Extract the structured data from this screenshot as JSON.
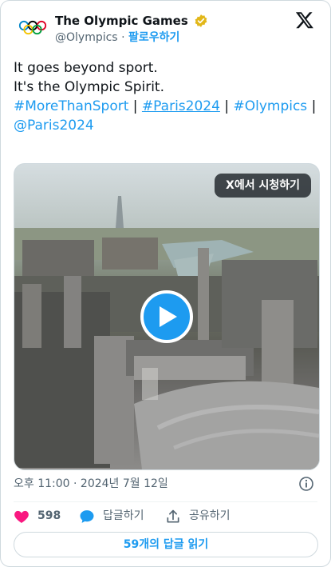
{
  "header": {
    "display_name": "The Olympic Games",
    "handle": "@Olympics",
    "dot": "·",
    "follow_label": "팔로우하기"
  },
  "tweet": {
    "line1": "It goes beyond sport.",
    "line2": "It's the Olympic Spirit.",
    "tags": [
      "#MoreThanSport",
      "#Paris2024",
      "#Olympics",
      "@Paris2024"
    ],
    "separator": "|"
  },
  "media": {
    "watch_label": "X에서 시청하기"
  },
  "meta": {
    "timestamp": "오후 11:00 · 2024년 7월 12일"
  },
  "actions": {
    "like_count": "598",
    "reply_label": "답글하기",
    "share_label": "공유하기"
  },
  "replies_button": {
    "label": "59개의 답글 읽기"
  },
  "colors": {
    "accent": "#1d9bf0",
    "like": "#f91880",
    "text": "#0f1419",
    "muted": "#536471"
  }
}
